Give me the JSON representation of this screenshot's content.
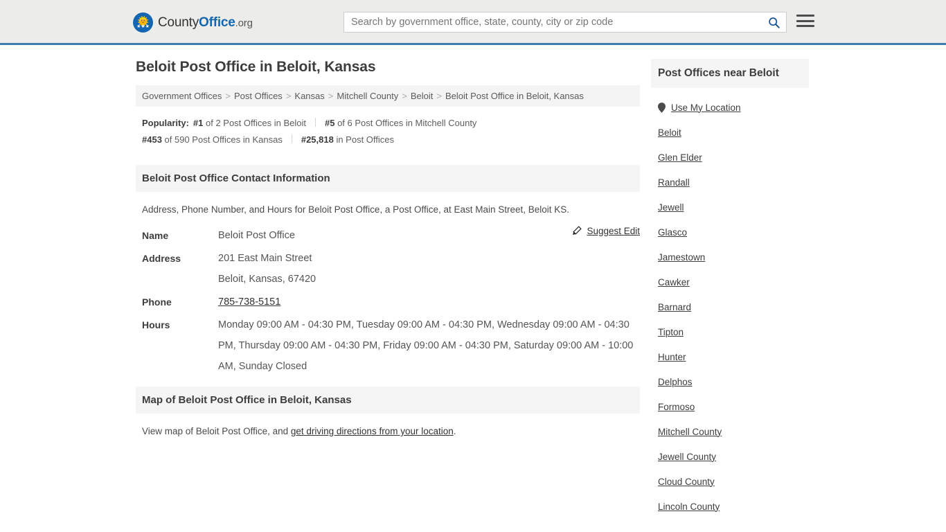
{
  "header": {
    "logo": {
      "part1": "County",
      "part2": "Office",
      "part3": ".org",
      "icon": "eagle-seal-icon"
    },
    "search": {
      "placeholder": "Search by government office, state, county, city or zip code",
      "value": "",
      "icon": "search-icon"
    },
    "menu_icon": "hamburger-menu-icon",
    "accent_color": "#3c7cb0",
    "background_color": "#ececea"
  },
  "page": {
    "title": "Beloit Post Office in Beloit, Kansas"
  },
  "breadcrumb": {
    "items": [
      "Government Offices",
      "Post Offices",
      "Kansas",
      "Mitchell County",
      "Beloit",
      "Beloit Post Office in Beloit, Kansas"
    ],
    "separator": ">"
  },
  "popularity": {
    "label": "Popularity:",
    "items": [
      {
        "rank": "#1",
        "rest": " of 2 Post Offices in Beloit"
      },
      {
        "rank": "#5",
        "rest": " of 6 Post Offices in Mitchell County"
      },
      {
        "rank": "#453",
        "rest": " of 590 Post Offices in Kansas"
      },
      {
        "rank": "#25,818",
        "rest": " in Post Offices"
      }
    ]
  },
  "contact": {
    "heading": "Beloit Post Office Contact Information",
    "description": "Address, Phone Number, and Hours for Beloit Post Office, a Post Office, at East Main Street, Beloit KS.",
    "suggest_edit": {
      "label": "Suggest Edit",
      "icon": "edit-pencil-icon"
    },
    "rows": {
      "name_label": "Name",
      "name_value": "Beloit Post Office",
      "address_label": "Address",
      "address_line1": "201 East Main Street",
      "address_line2": "Beloit, Kansas, 67420",
      "phone_label": "Phone",
      "phone_value": "785-738-5151",
      "hours_label": "Hours",
      "hours_value": "Monday 09:00 AM - 04:30 PM, Tuesday 09:00 AM - 04:30 PM, Wednesday 09:00 AM - 04:30 PM, Thursday 09:00 AM - 04:30 PM, Friday 09:00 AM - 04:30 PM, Saturday 09:00 AM - 10:00 AM, Sunday Closed"
    }
  },
  "map_section": {
    "heading": "Map of Beloit Post Office in Beloit, Kansas",
    "text_before": "View map of Beloit Post Office, and ",
    "link": "get driving directions from your location",
    "text_after": "."
  },
  "sidebar": {
    "heading": "Post Offices near Beloit",
    "use_my_location": {
      "label": "Use My Location",
      "icon": "map-pin-icon"
    },
    "items": [
      "Beloit",
      "Glen Elder",
      "Randall",
      "Jewell",
      "Glasco",
      "Jamestown",
      "Cawker",
      "Barnard",
      "Tipton",
      "Hunter",
      "Delphos",
      "Formoso",
      "Mitchell County",
      "Jewell County",
      "Cloud County",
      "Lincoln County"
    ]
  }
}
